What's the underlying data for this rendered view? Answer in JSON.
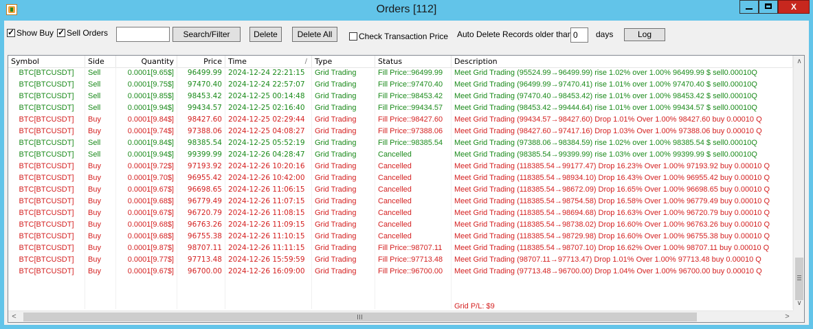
{
  "window": {
    "title": "Orders [112]",
    "close_label": "X"
  },
  "toolbar": {
    "show_buy_label": "Show Buy",
    "show_buy_checked": true,
    "sell_orders_label": "Sell Orders",
    "sell_orders_checked": true,
    "filter_value": "",
    "search_label": "Search/Filter",
    "delete_label": "Delete",
    "delete_all_label": "Delete All",
    "check_price_label": "Check Transaction Price",
    "check_price_checked": false,
    "auto_delete_label": "Auto Delete Records older than",
    "days_value": "0",
    "days_label": "days",
    "log_label": "Log"
  },
  "colors": {
    "sell": "#1a8a1a",
    "buy": "#d42020"
  },
  "table": {
    "columns": [
      "Symbol",
      "Side",
      "Quantity",
      "Price",
      "Time",
      "Type",
      "Status",
      "Description"
    ],
    "sort_indicator": "/",
    "rows": [
      {
        "symbol": "BTC[BTCUSDT]",
        "side": "Sell",
        "qty": "0.0001[9.65$]",
        "price": "96499.99",
        "time": "2024-12-24 22:21:15",
        "type": "Grid Trading",
        "status": "Fill Price::96499.99",
        "desc": "Meet Grid Trading (95524.99→96499.99) rise 1.02% over 1.00% 96499.99 $ sell0.00010Q"
      },
      {
        "symbol": "BTC[BTCUSDT]",
        "side": "Sell",
        "qty": "0.0001[9.75$]",
        "price": "97470.40",
        "time": "2024-12-24 22:57:07",
        "type": "Grid Trading",
        "status": "Fill Price::97470.40",
        "desc": "Meet Grid Trading (96499.99→97470.41) rise 1.01% over 1.00% 97470.40 $ sell0.00010Q"
      },
      {
        "symbol": "BTC[BTCUSDT]",
        "side": "Sell",
        "qty": "0.0001[9.85$]",
        "price": "98453.42",
        "time": "2024-12-25 00:14:48",
        "type": "Grid Trading",
        "status": "Fill Price::98453.42",
        "desc": "Meet Grid Trading (97470.40→98453.42) rise 1.01% over 1.00% 98453.42 $ sell0.00010Q"
      },
      {
        "symbol": "BTC[BTCUSDT]",
        "side": "Sell",
        "qty": "0.0001[9.94$]",
        "price": "99434.57",
        "time": "2024-12-25 02:16:40",
        "type": "Grid Trading",
        "status": "Fill Price::99434.57",
        "desc": "Meet Grid Trading (98453.42→99444.64) rise 1.01% over 1.00% 99434.57 $ sell0.00010Q"
      },
      {
        "symbol": "BTC[BTCUSDT]",
        "side": "Buy",
        "qty": "0.0001[9.84$]",
        "price": "98427.60",
        "time": "2024-12-25 02:29:44",
        "type": "Grid Trading",
        "status": "Fill Price::98427.60",
        "desc": "Meet Grid Trading (99434.57→98427.60) Drop 1.01% Over 1.00% 98427.60 buy 0.00010 Q"
      },
      {
        "symbol": "BTC[BTCUSDT]",
        "side": "Buy",
        "qty": "0.0001[9.74$]",
        "price": "97388.06",
        "time": "2024-12-25 04:08:27",
        "type": "Grid Trading",
        "status": "Fill Price::97388.06",
        "desc": "Meet Grid Trading (98427.60→97417.16) Drop 1.03% Over 1.00% 97388.06 buy 0.00010 Q"
      },
      {
        "symbol": "BTC[BTCUSDT]",
        "side": "Sell",
        "qty": "0.0001[9.84$]",
        "price": "98385.54",
        "time": "2024-12-25 05:52:19",
        "type": "Grid Trading",
        "status": "Fill Price::98385.54",
        "desc": "Meet Grid Trading (97388.06→98384.59) rise 1.02% over 1.00% 98385.54 $ sell0.00010Q"
      },
      {
        "symbol": "BTC[BTCUSDT]",
        "side": "Sell",
        "qty": "0.0001[9.94$]",
        "price": "99399.99",
        "time": "2024-12-26 04:28:47",
        "type": "Grid Trading",
        "status": "Cancelled",
        "desc": "Meet Grid Trading (98385.54→99399.99) rise 1.03% over 1.00% 99399.99 $ sell0.00010Q"
      },
      {
        "symbol": "BTC[BTCUSDT]",
        "side": "Buy",
        "qty": "0.0001[9.72$]",
        "price": "97193.92",
        "time": "2024-12-26 10:20:16",
        "type": "Grid Trading",
        "status": "Cancelled",
        "desc": "Meet Grid Trading (118385.54→99177.47) Drop 16.23% Over 1.00% 97193.92 buy 0.00010 Q"
      },
      {
        "symbol": "BTC[BTCUSDT]",
        "side": "Buy",
        "qty": "0.0001[9.70$]",
        "price": "96955.42",
        "time": "2024-12-26 10:42:00",
        "type": "Grid Trading",
        "status": "Cancelled",
        "desc": "Meet Grid Trading (118385.54→98934.10) Drop 16.43% Over 1.00% 96955.42 buy 0.00010 Q"
      },
      {
        "symbol": "BTC[BTCUSDT]",
        "side": "Buy",
        "qty": "0.0001[9.67$]",
        "price": "96698.65",
        "time": "2024-12-26 11:06:15",
        "type": "Grid Trading",
        "status": "Cancelled",
        "desc": "Meet Grid Trading (118385.54→98672.09) Drop 16.65% Over 1.00% 96698.65 buy 0.00010 Q"
      },
      {
        "symbol": "BTC[BTCUSDT]",
        "side": "Buy",
        "qty": "0.0001[9.68$]",
        "price": "96779.49",
        "time": "2024-12-26 11:07:15",
        "type": "Grid Trading",
        "status": "Cancelled",
        "desc": "Meet Grid Trading (118385.54→98754.58) Drop 16.58% Over 1.00% 96779.49 buy 0.00010 Q"
      },
      {
        "symbol": "BTC[BTCUSDT]",
        "side": "Buy",
        "qty": "0.0001[9.67$]",
        "price": "96720.79",
        "time": "2024-12-26 11:08:15",
        "type": "Grid Trading",
        "status": "Cancelled",
        "desc": "Meet Grid Trading (118385.54→98694.68) Drop 16.63% Over 1.00% 96720.79 buy 0.00010 Q"
      },
      {
        "symbol": "BTC[BTCUSDT]",
        "side": "Buy",
        "qty": "0.0001[9.68$]",
        "price": "96763.26",
        "time": "2024-12-26 11:09:15",
        "type": "Grid Trading",
        "status": "Cancelled",
        "desc": "Meet Grid Trading (118385.54→98738.02) Drop 16.60% Over 1.00% 96763.26 buy 0.00010 Q"
      },
      {
        "symbol": "BTC[BTCUSDT]",
        "side": "Buy",
        "qty": "0.0001[9.68$]",
        "price": "96755.38",
        "time": "2024-12-26 11:10:15",
        "type": "Grid Trading",
        "status": "Cancelled",
        "desc": "Meet Grid Trading (118385.54→98729.98) Drop 16.60% Over 1.00% 96755.38 buy 0.00010 Q"
      },
      {
        "symbol": "BTC[BTCUSDT]",
        "side": "Buy",
        "qty": "0.0001[9.87$]",
        "price": "98707.11",
        "time": "2024-12-26 11:11:15",
        "type": "Grid Trading",
        "status": "Fill Price::98707.11",
        "desc": "Meet Grid Trading (118385.54→98707.10) Drop 16.62% Over 1.00% 98707.11 buy 0.00010 Q"
      },
      {
        "symbol": "BTC[BTCUSDT]",
        "side": "Buy",
        "qty": "0.0001[9.77$]",
        "price": "97713.48",
        "time": "2024-12-26 15:59:59",
        "type": "Grid Trading",
        "status": "Fill Price::97713.48",
        "desc": "Meet Grid Trading (98707.11→97713.47) Drop 1.01% Over 1.00% 97713.48 buy 0.00010 Q"
      },
      {
        "symbol": "BTC[BTCUSDT]",
        "side": "Buy",
        "qty": "0.0001[9.67$]",
        "price": "96700.00",
        "time": "2024-12-26 16:09:00",
        "type": "Grid Trading",
        "status": "Fill Price::96700.00",
        "desc": "Meet Grid Trading (97713.48→96700.00) Drop 1.04% Over 1.00% 96700.00 buy 0.00010 Q"
      }
    ],
    "summary": "Grid P/L: $9"
  }
}
